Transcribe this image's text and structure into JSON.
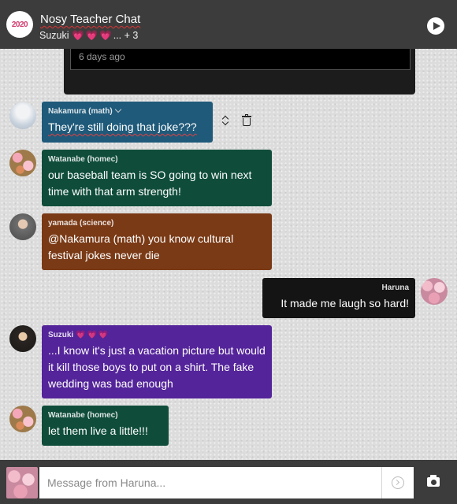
{
  "header": {
    "logo_text": "2020",
    "title": "Nosy Teacher Chat",
    "members": "Suzuki",
    "members_hearts": "💗💗💗",
    "members_more": "... + 3"
  },
  "media_card": {
    "time": "6 days ago"
  },
  "messages": [
    {
      "sender": "Nakamura (math)",
      "text": "They're still doing that joke???"
    },
    {
      "sender": "Watanabe (homec)",
      "text": "our baseball team is SO going to win next time with that arm strength!"
    },
    {
      "sender": "yamada (science)",
      "text": "@Nakamura (math) you know cultural festival jokes never die"
    },
    {
      "sender": "Haruna",
      "text": "It made me laugh so hard!"
    },
    {
      "sender": "Suzuki",
      "hearts": "💗💗💗",
      "text": "...I know it's just a vacation picture but would it kill those boys to put on a shirt. The fake wedding was bad enough"
    },
    {
      "sender": "Watanabe (homec)",
      "text": "let them live a little!!!"
    }
  ],
  "footer": {
    "placeholder": "Message from Haruna..."
  },
  "colors": {
    "header_bg": "#3c3c3c",
    "nakamura": "#1f5a7a",
    "watanabe": "#0f4d3a",
    "yamada": "#7a3a16",
    "haruna": "#141414",
    "suzuki": "#54249a"
  },
  "icons": [
    "play-icon",
    "chevron-down-icon",
    "sort-icon",
    "trash-icon",
    "send-icon",
    "camera-icon"
  ]
}
